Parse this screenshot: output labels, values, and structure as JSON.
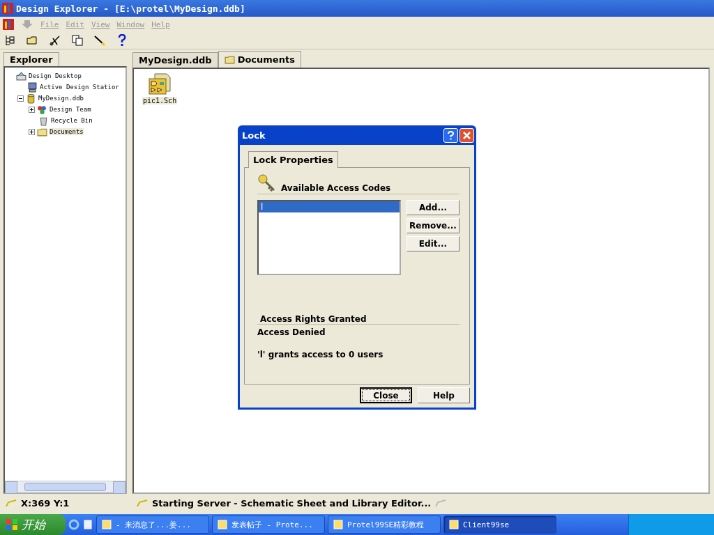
{
  "window": {
    "title": "Design Explorer - [E:\\protel\\MyDesign.ddb]"
  },
  "menu": [
    "File",
    "Edit",
    "View",
    "Window",
    "Help"
  ],
  "explorer": {
    "tab": "Explorer",
    "tree": [
      {
        "label": "Design Desktop",
        "kind": "desktop",
        "selected": false,
        "children": [
          {
            "label": "Active Design Statior",
            "kind": "station",
            "selected": false
          },
          {
            "label": "MyDesign.ddb",
            "kind": "db",
            "selected": false,
            "expanded": true,
            "children": [
              {
                "label": "Design Team",
                "kind": "team",
                "selected": false,
                "expanded": false
              },
              {
                "label": "Recycle Bin",
                "kind": "bin",
                "selected": false
              },
              {
                "label": "Documents",
                "kind": "folder",
                "selected": true,
                "expanded": false
              }
            ]
          }
        ]
      }
    ]
  },
  "doc_tabs": [
    {
      "label": "MyDesign.ddb",
      "selected": false,
      "kind": "db"
    },
    {
      "label": "Documents",
      "selected": true,
      "kind": "folder"
    }
  ],
  "files": [
    {
      "label": "pic1.Sch"
    }
  ],
  "dialog": {
    "title": "Lock",
    "tab": "Lock Properties",
    "codes_heading": "Available Access Codes",
    "codes": [
      {
        "label": "l",
        "selected": true
      }
    ],
    "buttons": [
      "Add...",
      "Remove...",
      "Edit..."
    ],
    "rights_heading": "Access Rights Granted",
    "rights": "Access Denied",
    "summary": "'l' grants access to 0 users",
    "footer": [
      {
        "label": "Close",
        "default": true
      },
      {
        "label": "Help",
        "default": false
      }
    ]
  },
  "status_bar": {
    "coords": "X:369 Y:1",
    "message": "Starting Server - Schematic Sheet and Library Editor..."
  },
  "taskbar": {
    "start": "开始",
    "tasks": [
      {
        "label": "- 来消息了...姜...",
        "selected": false
      },
      {
        "label": "发表帖子 - Prote...",
        "selected": false
      },
      {
        "label": "Protel99SE精彩教程",
        "selected": false
      },
      {
        "label": "Client99se",
        "selected": true
      }
    ]
  }
}
